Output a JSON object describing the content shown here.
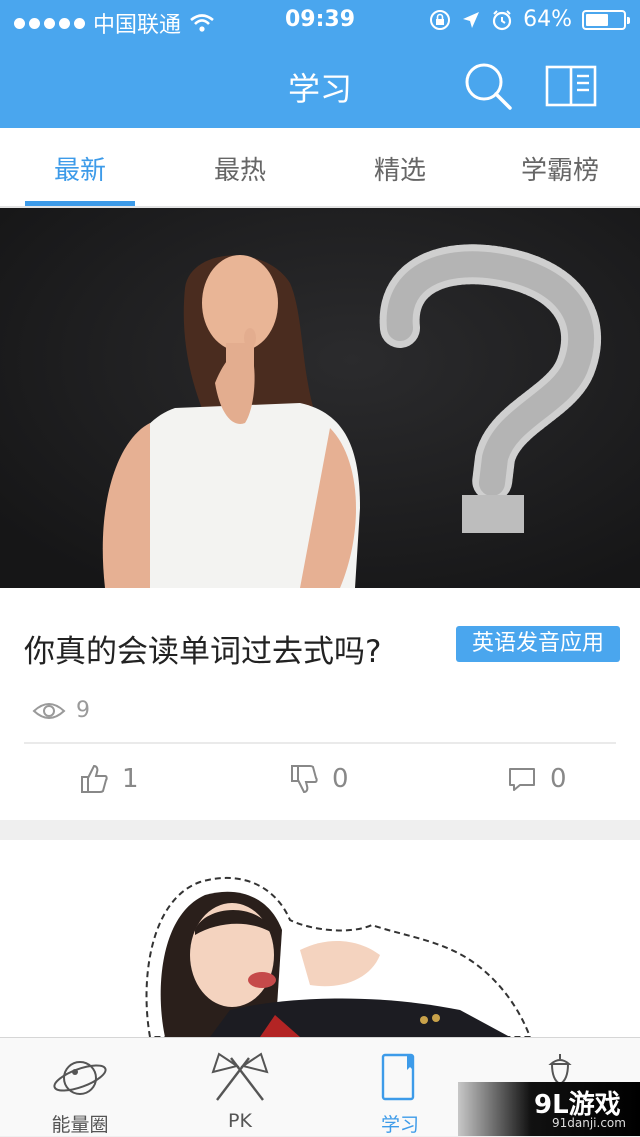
{
  "status": {
    "carrier": "中国联通",
    "time": "09:39",
    "battery": "64%",
    "battery_level": 0.64
  },
  "header": {
    "title": "学习"
  },
  "tabs": [
    {
      "label": "最新",
      "active": true
    },
    {
      "label": "最热",
      "active": false
    },
    {
      "label": "精选",
      "active": false
    },
    {
      "label": "学霸榜",
      "active": false
    }
  ],
  "post": {
    "title": "你真的会读单词过去式吗?",
    "tag": "英语发音应用",
    "views": "9",
    "likes": "1",
    "dislikes": "0",
    "comments": "0"
  },
  "bottom_nav": [
    {
      "label": "能量圈",
      "icon": "planet-icon"
    },
    {
      "label": "PK",
      "icon": "flags-icon"
    },
    {
      "label": "学习",
      "icon": "notebook-icon",
      "active": true
    },
    {
      "label": "",
      "icon": "acorn-icon"
    }
  ],
  "watermark": {
    "brand": "9L游戏",
    "url": "91danji.com"
  },
  "colors": {
    "accent": "#4aa6ee",
    "tab_active": "#3d9be9"
  }
}
